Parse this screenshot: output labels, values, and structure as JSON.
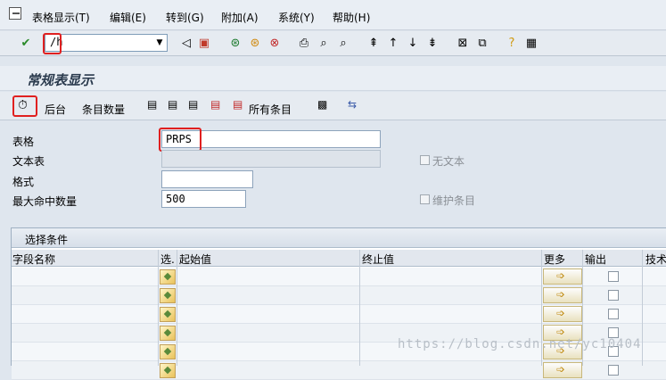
{
  "menu": {
    "items": [
      "表格显示(T)",
      "编辑(E)",
      "转到(G)",
      "附加(A)",
      "系统(Y)",
      "帮助(H)"
    ]
  },
  "toolbar": {
    "command_value": "/h"
  },
  "page": {
    "title": "常规表显示"
  },
  "app_toolbar": {
    "background_label": "后台",
    "entry_count_label": "条目数量",
    "all_entries_label": "所有条目"
  },
  "fields": {
    "table_label": "表格",
    "table_value": "PRPS",
    "text_table_label": "文本表",
    "no_text_label": "无文本",
    "layout_label": "格式",
    "max_hits_label": "最大命中数量",
    "max_hits_value": "500",
    "maintain_entries_label": "维护条目"
  },
  "selection": {
    "title": "选择条件",
    "columns": [
      "字段名称",
      "选.",
      "起始值",
      "终止值",
      "更多",
      "输出",
      "技术"
    ],
    "row_count": 6
  },
  "watermark": "https://blog.csdn.net/yc10404",
  "colors": {
    "highlight": "#e02020",
    "background": "#dfe6ee"
  }
}
